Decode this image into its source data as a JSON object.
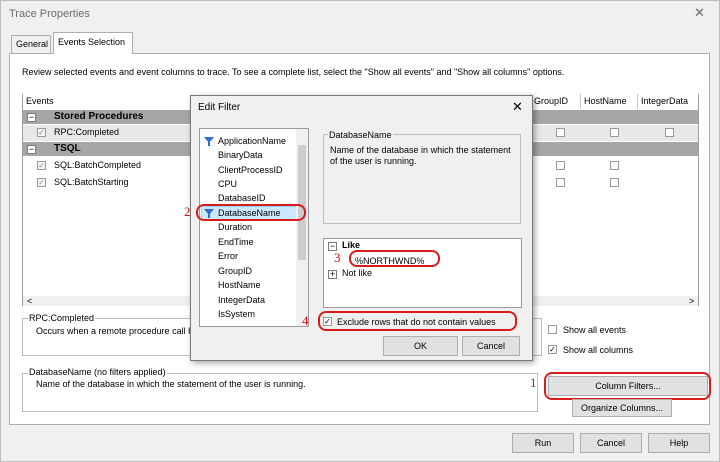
{
  "window": {
    "title": "Trace Properties",
    "close_glyph": "✕"
  },
  "tabs": [
    {
      "label": "General"
    },
    {
      "label": "Events Selection"
    }
  ],
  "intro_text": "Review selected events and event columns to trace. To see a complete list, select the \"Show all events\" and \"Show all columns\" options.",
  "grid": {
    "columns": [
      "Events",
      "GroupID",
      "HostName",
      "IntegerData"
    ],
    "rows": [
      {
        "label": "Stored Procedures",
        "kind": "category"
      },
      {
        "label": "RPC:Completed",
        "kind": "event"
      },
      {
        "label": "TSQL",
        "kind": "category"
      },
      {
        "label": "SQL:BatchCompleted",
        "kind": "event"
      },
      {
        "label": "SQL:BatchStarting",
        "kind": "event"
      }
    ],
    "scroll_left": "<",
    "scroll_right": ">"
  },
  "event_info": {
    "title": "RPC:Completed",
    "text": "Occurs when a remote procedure call h"
  },
  "column_info": {
    "title": "DatabaseName (no filters applied)",
    "text": "Name of the database in which the statement of the user is running."
  },
  "options": {
    "show_all_events": "Show all events",
    "show_all_columns": "Show all columns",
    "show_all_events_checked": false,
    "show_all_columns_checked": true
  },
  "buttons": {
    "column_filters": "Column Filters...",
    "organize_columns": "Organize Columns...",
    "run": "Run",
    "cancel": "Cancel",
    "help": "Help"
  },
  "dialog": {
    "title": "Edit Filter",
    "close_glyph": "✕",
    "columns": [
      "ApplicationName",
      "BinaryData",
      "ClientProcessID",
      "CPU",
      "DatabaseID",
      "DatabaseName",
      "Duration",
      "EndTime",
      "Error",
      "GroupID",
      "HostName",
      "IntegerData",
      "IsSystem"
    ],
    "filtered_columns": [
      "ApplicationName",
      "DatabaseName"
    ],
    "selected_column": "DatabaseName",
    "desc_title": "DatabaseName",
    "desc_text": "Name of the database in which the statement of the user is running.",
    "tree": {
      "like_label": "Like",
      "like_value": "%NORTHWND%",
      "not_like_label": "Not like"
    },
    "exclude_label": "Exclude rows that do not contain values",
    "exclude_checked": true,
    "ok": "OK",
    "cancel": "Cancel"
  },
  "annotations": [
    "1",
    "2",
    "3",
    "4"
  ],
  "colors": {
    "annotation_red": "#d81c1c",
    "selection": "#cce8ff",
    "filter_icon": "#2d6bd6",
    "category_row": "#a6a6a6"
  }
}
